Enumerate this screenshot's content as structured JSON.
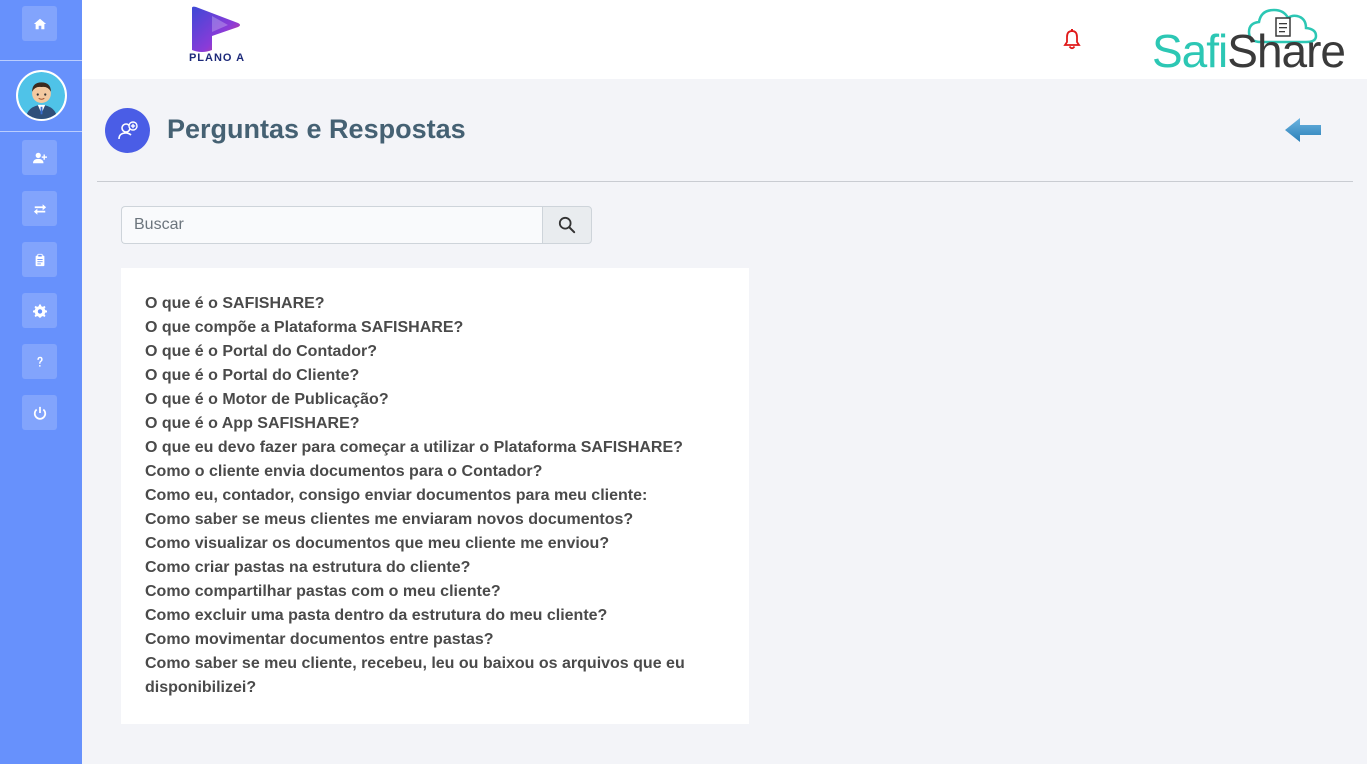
{
  "header": {
    "brand_left": "PLANO A",
    "brand_right_part1": "Safi",
    "brand_right_part2": "Share",
    "accent_color": "#6791fc",
    "notification_color": "#e01919"
  },
  "sidebar": {
    "items": [
      {
        "icon": "home-icon"
      },
      {
        "icon": "add-user-icon"
      },
      {
        "icon": "transfer-icon"
      },
      {
        "icon": "clipboard-icon"
      },
      {
        "icon": "gear-icon"
      },
      {
        "icon": "question-icon"
      },
      {
        "icon": "power-icon"
      }
    ]
  },
  "page": {
    "title": "Perguntas e Respostas"
  },
  "search": {
    "placeholder": "Buscar",
    "value": ""
  },
  "faq": {
    "items": [
      "O que é o SAFISHARE?",
      "O que compõe a Plataforma SAFISHARE?",
      "O que é o Portal do Contador?",
      "O que é o Portal do Cliente?",
      "O que é o Motor de Publicação?",
      "O que é o App SAFISHARE?",
      "O que eu devo fazer para começar a utilizar o Plataforma SAFISHARE?",
      "Como o cliente envia documentos para o Contador?",
      "Como eu, contador, consigo enviar documentos para meu cliente:",
      "Como saber se meus clientes me enviaram novos documentos?",
      "Como visualizar os documentos que meu cliente me enviou?",
      "Como criar pastas na estrutura do cliente?",
      "Como compartilhar pastas com o meu cliente?",
      "Como excluir uma pasta dentro da estrutura do meu cliente?",
      "Como movimentar documentos entre pastas?",
      "Como saber se meu cliente, recebeu, leu ou baixou os arquivos que eu disponibilizei?"
    ]
  }
}
